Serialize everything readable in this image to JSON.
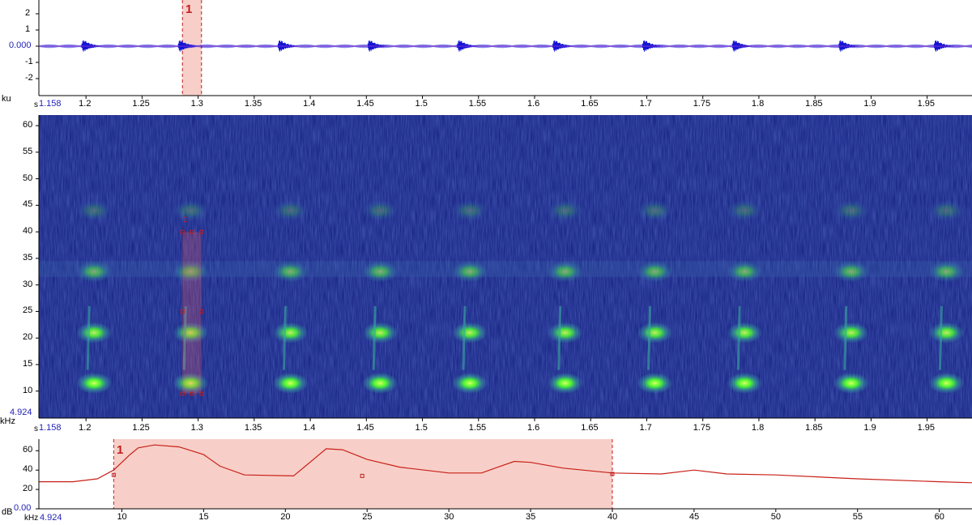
{
  "colors": {
    "wave": "#1414d6",
    "centerline": "#7a2fd0",
    "selection_fill": "#f7cfc8",
    "selection_line": "#c02020",
    "spec_bg": "#101a7a",
    "spec_glow": "#4cff2c",
    "spec_mid": "#38a8a0",
    "power_line": "#c82018"
  },
  "waveform": {
    "unit_label": "ku",
    "y_ticks": [
      "2",
      "1",
      "0.000",
      "-1",
      "-2"
    ],
    "time_axis_unit": "s",
    "time_start": "1.158",
    "time_ticks": [
      "1.2",
      "1.25",
      "1.3",
      "1.35",
      "1.4",
      "1.45",
      "1.5",
      "1.55",
      "1.6",
      "1.65",
      "1.7",
      "1.75",
      "1.8",
      "1.85",
      "1.9",
      "1.95"
    ],
    "selection_label": "1",
    "selection": {
      "start_s": 1.286,
      "end_s": 1.303
    },
    "calls_s": [
      1.2,
      1.286,
      1.375,
      1.455,
      1.535,
      1.62,
      1.7,
      1.78,
      1.875,
      1.96
    ]
  },
  "spectrogram": {
    "unit_label": "kHz",
    "y_ticks": [
      "60",
      "55",
      "50",
      "45",
      "40",
      "35",
      "30",
      "25",
      "20",
      "15",
      "10"
    ],
    "y_min_label": "4.924",
    "time_axis_unit": "s",
    "time_start": "1.158",
    "time_ticks": [
      "1.2",
      "1.25",
      "1.3",
      "1.35",
      "1.4",
      "1.45",
      "1.5",
      "1.55",
      "1.6",
      "1.65",
      "1.7",
      "1.75",
      "1.8",
      "1.85",
      "1.9",
      "1.95"
    ],
    "selection_label": "1",
    "selection": {
      "start_s": 1.286,
      "end_s": 1.303,
      "low_khz": 9.5,
      "high_khz": 40
    }
  },
  "power_spectrum": {
    "unit_label": "dB",
    "y_ticks": [
      "60",
      "40",
      "20",
      "0.00"
    ],
    "x_unit": "kHz",
    "x_start": "4.924",
    "x_ticks": [
      "10",
      "15",
      "20",
      "25",
      "30",
      "35",
      "40",
      "45",
      "50",
      "55",
      "60"
    ],
    "selection_label": "1",
    "selection": {
      "low_khz": 9.5,
      "high_khz": 40
    },
    "curve": [
      [
        4.924,
        28
      ],
      [
        7,
        28
      ],
      [
        8.5,
        31
      ],
      [
        9.5,
        40
      ],
      [
        10.5,
        56
      ],
      [
        11,
        63
      ],
      [
        12,
        66
      ],
      [
        13.5,
        64
      ],
      [
        15,
        56
      ],
      [
        16,
        44
      ],
      [
        17.5,
        35
      ],
      [
        20.5,
        34
      ],
      [
        21.5,
        48
      ],
      [
        22.5,
        62
      ],
      [
        23.5,
        61
      ],
      [
        25,
        51
      ],
      [
        27,
        43
      ],
      [
        30,
        37
      ],
      [
        32,
        37
      ],
      [
        33,
        43
      ],
      [
        34,
        49
      ],
      [
        35,
        48
      ],
      [
        37,
        42
      ],
      [
        40,
        37
      ],
      [
        43,
        36
      ],
      [
        45,
        40
      ],
      [
        47,
        36
      ],
      [
        50,
        35
      ],
      [
        55,
        31
      ],
      [
        60,
        28
      ],
      [
        62,
        27
      ]
    ]
  }
}
